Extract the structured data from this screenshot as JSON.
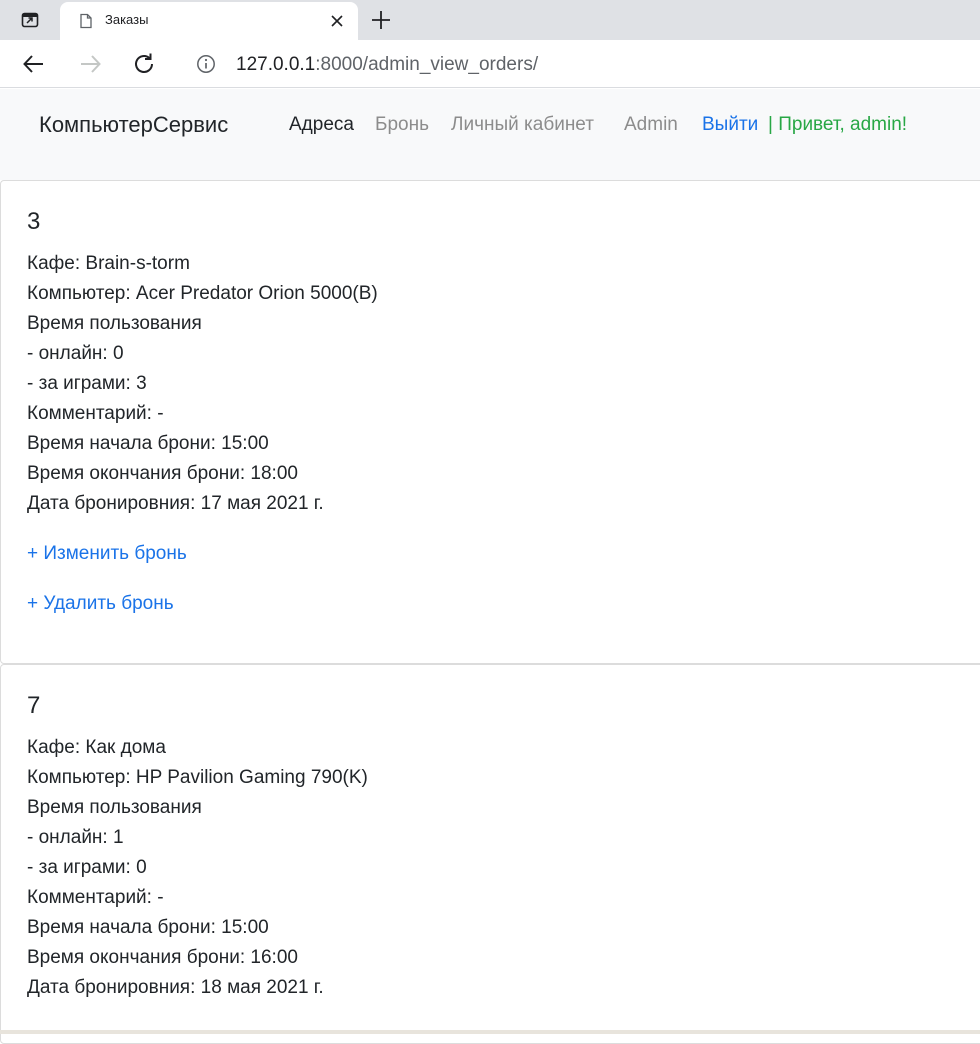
{
  "browser": {
    "tab_title": "Заказы",
    "url_host": "127.0.0.1",
    "url_rest": ":8000/admin_view_orders/"
  },
  "navbar": {
    "brand": "КомпьютерСервис",
    "links": [
      "Адреса",
      "Бронь",
      "Личный кабинет",
      "Admin"
    ],
    "logout": "Выйти",
    "greeting": "| Привет, admin!"
  },
  "orders": [
    {
      "id": "3",
      "cafe": "Кафе: Brain-s-torm",
      "computer": "Компьютер: Acer Predator Orion 5000(B)",
      "usage_header": "Время пользования",
      "online": "- онлайн: 0",
      "games": "- за играми: 3",
      "comment": "Комментарий: -",
      "start": "Время начала брони: 15:00",
      "end": "Время окончания брони: 18:00",
      "date": "Дата бронировния: 17 мая 2021 г.",
      "edit_label": "+ Изменить бронь",
      "delete_label": "+ Удалить бронь"
    },
    {
      "id": "7",
      "cafe": "Кафе: Как дома",
      "computer": "Компьютер: HP Pavilion Gaming 790(K)",
      "usage_header": "Время пользования",
      "online": "- онлайн: 1",
      "games": "- за играми: 0",
      "comment": "Комментарий: -",
      "start": "Время начала брони: 15:00",
      "end": "Время окончания брони: 16:00",
      "date": "Дата бронировния: 18 мая 2021 г."
    }
  ]
}
